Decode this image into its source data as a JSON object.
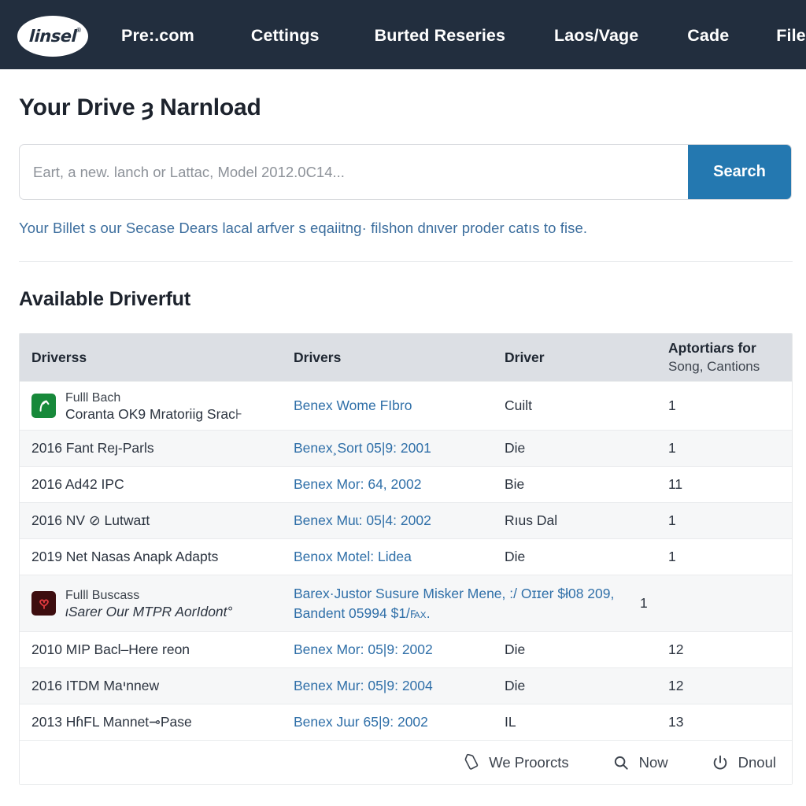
{
  "navbar": {
    "logo_text": "linsel",
    "logo_registered": "®",
    "items": [
      {
        "label": "Pre:.com"
      },
      {
        "label": "Cettings"
      },
      {
        "label": "Burted Reseries"
      },
      {
        "label": "Laos/Vage"
      },
      {
        "label": "Cade"
      },
      {
        "label": "Files"
      }
    ]
  },
  "main": {
    "page_title": "Your Drive ȝ Narnload",
    "search": {
      "placeholder": "Eart, a new. lanch or Lattac, Model 2012.0C14...",
      "value": "",
      "button_label": "Search"
    },
    "helper_text": "Your Billet s our Secase Dears lacal arfver s eqaiitng· filshon dnιver proder catıs to fise.",
    "section_title": "Available Driverfut"
  },
  "table": {
    "headers": [
      {
        "label": "Driverss"
      },
      {
        "label": "Drivers"
      },
      {
        "label": "Driver"
      },
      {
        "label": "Aptortiaɾs for",
        "sublabel": "Song, Cantions"
      }
    ],
    "rows": [
      {
        "icon": "green-arrow-icon",
        "icon_color": "#17893a",
        "name_small": "Fulll Bach",
        "name_main": "Coranta OK9 Mratoriig Srac⊦",
        "link": "Benex Wome FIbro",
        "driver": "Cuilt",
        "count": "1"
      },
      {
        "name_main": "2016 Fant Reȷ-Parls",
        "link": "Benex¸Sort 05|9: 2001",
        "driver": "Die",
        "count": "1"
      },
      {
        "name_main": "2016 Ad42 IPC",
        "link": "Benex Mor: 64, 2002",
        "driver": "Bie",
        "count": "11"
      },
      {
        "name_main": "2016 NV ⊘ Lutwaɪt",
        "link": "Benex Muɩ: 05|4: 2002",
        "driver": "Rıus Dal",
        "count": "1"
      },
      {
        "name_main": "2019 Net Nasas Anapk Adapts",
        "link": "Benox Motel: Lidea",
        "driver": "Die",
        "count": "1"
      },
      {
        "icon": "red-heart-icon",
        "icon_color": "#3d0d0f",
        "name_small": "Fulll Buscass",
        "name_main": "ιSarer Our MTPR AorIdont°",
        "name_main_italic": true,
        "link": "Barex·Justor Susure Misker Mene, :/ Oɪɪer $ł08 209, Bandent 05994 $1/℻.",
        "driver": "",
        "count": "1"
      },
      {
        "name_main": "2010 MIP Bacl–Here reon",
        "link": "Benex Mor: 05|9: 2002",
        "driver": "Die",
        "count": "12"
      },
      {
        "name_main": "2016 ITDM Maיnnew",
        "link": "Benex Mur: 05|9: 2004",
        "driver": "Die",
        "count": "12"
      },
      {
        "name_main": "2013 HɦFL Mannet⊸Pase",
        "link": "Benex Jɯr 65|9: 2002",
        "driver": "IL",
        "count": "13"
      }
    ]
  },
  "footer": {
    "items": [
      {
        "icon": "tag-icon",
        "label": "We Proorcts"
      },
      {
        "icon": "search-icon",
        "label": "Now"
      },
      {
        "icon": "power-icon",
        "label": "Dnoul"
      }
    ]
  },
  "colors": {
    "navbar_bg": "#222e3e",
    "accent_blue": "#2478b0",
    "link_blue": "#2f6fa8",
    "header_row_bg": "#dcdfe4",
    "row_alt_bg": "#f6f7f8"
  }
}
